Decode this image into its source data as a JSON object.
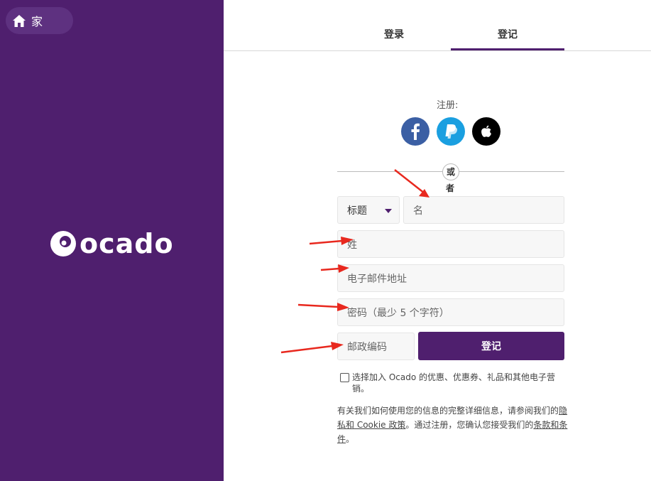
{
  "nav": {
    "home_label": "家",
    "home_icon": "home-icon"
  },
  "brand": {
    "name": "ocado",
    "left_panel_color": "#4f1f6e"
  },
  "tabs": [
    {
      "label": "登录",
      "active": false
    },
    {
      "label": "登记",
      "active": true
    }
  ],
  "social": {
    "label": "注册:",
    "providers": [
      {
        "name": "facebook",
        "icon": "facebook-icon",
        "color": "#3b5fa4"
      },
      {
        "name": "paypal",
        "icon": "paypal-icon",
        "color": "#1a9fe0"
      },
      {
        "name": "apple",
        "icon": "apple-icon",
        "color": "#000000"
      }
    ]
  },
  "divider": {
    "or_line1": "或",
    "or_line2": "者"
  },
  "form": {
    "title_select": {
      "value": "标题"
    },
    "first_name": {
      "placeholder": "名"
    },
    "last_name": {
      "placeholder": "姓"
    },
    "email": {
      "placeholder": "电子邮件地址"
    },
    "password": {
      "placeholder": "密码（最少 5 个字符）"
    },
    "postcode": {
      "placeholder": "邮政编码"
    },
    "submit_label": "登记"
  },
  "optin": {
    "text": "选择加入 Ocado 的优惠、优惠券、礼品和其他电子营销。",
    "checked": false
  },
  "legal": {
    "text1": "有关我们如何使用您的信息的完整详细信息，请参阅我们的",
    "privacy_link": "隐私和 Cookie 政策",
    "text2": "。通过注册，您确认您接受我们的",
    "terms_link": "条款和条件",
    "text3": "。"
  },
  "annotations": {
    "arrow_color": "#e8281e"
  }
}
